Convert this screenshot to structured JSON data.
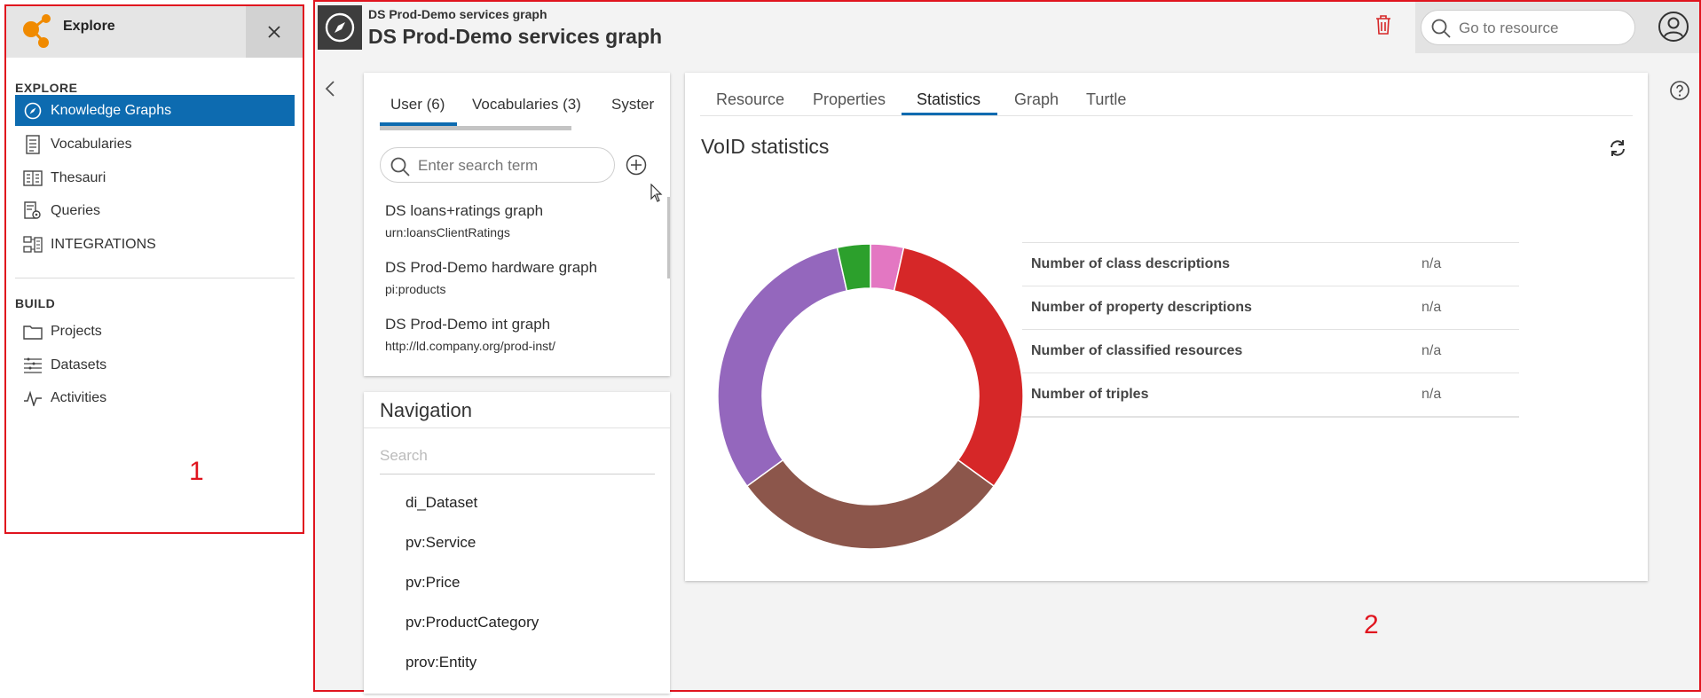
{
  "sidebar": {
    "title": "Explore",
    "sections": [
      {
        "label": "EXPLORE",
        "items": [
          {
            "label": "Knowledge Graphs",
            "icon": "compass-icon",
            "active": true
          },
          {
            "label": "Vocabularies",
            "icon": "list-doc-icon"
          },
          {
            "label": "Thesauri",
            "icon": "book-icon"
          },
          {
            "label": "Queries",
            "icon": "query-icon"
          },
          {
            "label": "INTEGRATIONS",
            "icon": "integrations-icon"
          }
        ]
      },
      {
        "label": "BUILD",
        "items": [
          {
            "label": "Projects",
            "icon": "folder-icon"
          },
          {
            "label": "Datasets",
            "icon": "datasets-icon"
          },
          {
            "label": "Activities",
            "icon": "activity-icon"
          }
        ]
      }
    ],
    "annotation": "1"
  },
  "header": {
    "subtitle": "DS Prod-Demo services graph",
    "title": "DS Prod-Demo services graph",
    "search_placeholder": "Go to resource"
  },
  "list_panel": {
    "tabs": [
      "User (6)",
      "Vocabularies (3)",
      "Syster"
    ],
    "search_placeholder": "Enter search term",
    "items": [
      {
        "title": "DS loans+ratings graph",
        "uri": "urn:loansClientRatings"
      },
      {
        "title": "DS Prod-Demo hardware graph",
        "uri": "pi:products"
      },
      {
        "title": "DS Prod-Demo int graph",
        "uri": "http://ld.company.org/prod-inst/"
      }
    ]
  },
  "navigation": {
    "title": "Navigation",
    "search_placeholder": "Search",
    "items": [
      "di_Dataset",
      "pv:Service",
      "pv:Price",
      "pv:ProductCategory",
      "prov:Entity"
    ]
  },
  "detail": {
    "tabs": [
      "Resource",
      "Properties",
      "Statistics",
      "Graph",
      "Turtle"
    ],
    "active_tab": "Statistics",
    "section_title": "VoID statistics",
    "stats": [
      {
        "label": "Number of class descriptions",
        "value": "n/a"
      },
      {
        "label": "Number of property descriptions",
        "value": "n/a"
      },
      {
        "label": "Number of classified resources",
        "value": "n/a"
      },
      {
        "label": "Number of triples",
        "value": "n/a"
      }
    ]
  },
  "chart_data": {
    "type": "pie",
    "donut": true,
    "slices": [
      {
        "value": 3.5,
        "color": "#e377c2"
      },
      {
        "value": 31.5,
        "color": "#d62728"
      },
      {
        "value": 30.0,
        "color": "#8c564b"
      },
      {
        "value": 31.5,
        "color": "#9467bd"
      },
      {
        "value": 3.5,
        "color": "#2ca02c"
      }
    ]
  },
  "annotation_main": "2",
  "colors": {
    "accent": "#0d6bb0",
    "highlight_border": "#e0141e",
    "logo": "#f08a00"
  }
}
